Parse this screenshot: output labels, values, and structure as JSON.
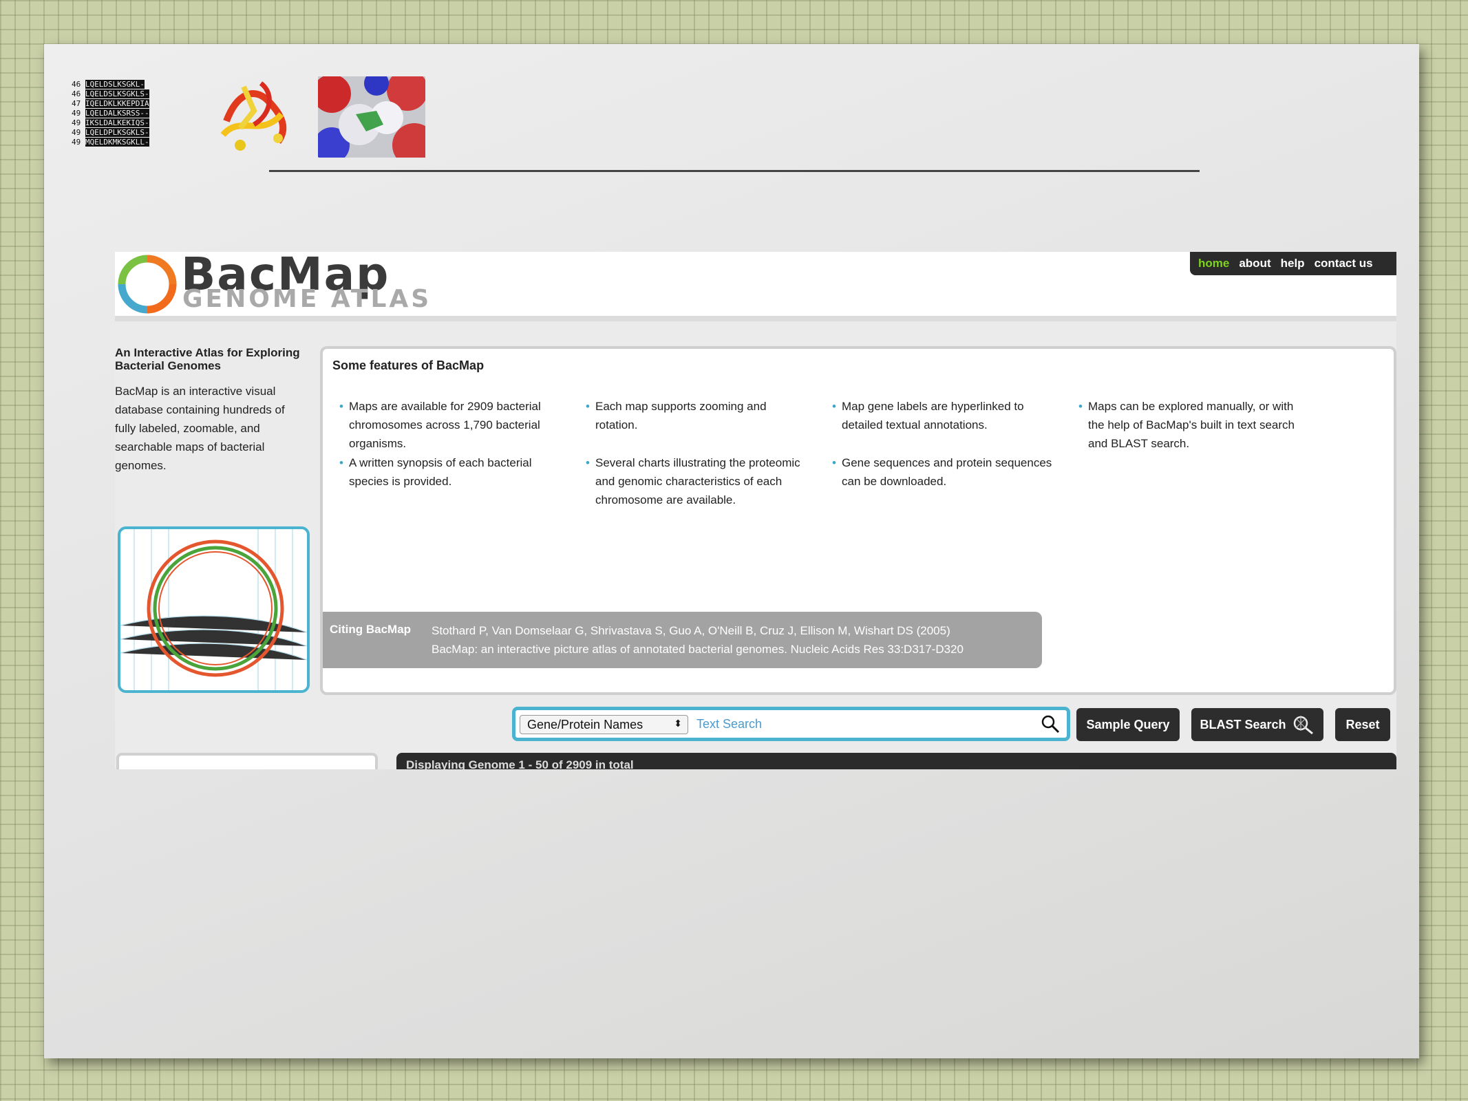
{
  "header": {
    "sequence_rows": [
      {
        "num": "46",
        "seq": "LQELDSLKSGKL-"
      },
      {
        "num": "46",
        "seq": "LQELDSLKSGKLS-"
      },
      {
        "num": "47",
        "seq": "IQELDKLKKEPDIA"
      },
      {
        "num": "49",
        "seq": "LQELDALKSRSS--"
      },
      {
        "num": "49",
        "seq": "IKSLDALKEKIQS-"
      },
      {
        "num": "49",
        "seq": "LQELDPLKSGKLS-"
      },
      {
        "num": "49",
        "seq": "MQELDKMKSGKLL-"
      }
    ]
  },
  "bacmap": {
    "logo_title": "BacMap",
    "logo_subtitle": "GENOME ATLAS",
    "nav": [
      "home",
      "about",
      "help",
      "contact us"
    ],
    "sidebar": {
      "heading": "An Interactive Atlas for Exploring Bacterial Genomes",
      "text": "BacMap is an interactive visual database containing hundreds of fully labeled, zoomable, and searchable maps of bacterial genomes."
    },
    "features": {
      "title": "Some features of BacMap",
      "items": [
        "Maps are available for 2909 bacterial chromosomes across 1,790 bacterial organisms.",
        "Each map supports zooming and rotation.",
        "Map gene labels are hyperlinked to detailed textual annotations.",
        "Maps can be explored manually, or with the help of BacMap's built in text search and BLAST search.",
        "A written synopsis of each bacterial species is provided.",
        "Several charts illustrating the proteomic and genomic characteristics of each chromosome are available.",
        "Gene sequences and protein sequences can be downloaded."
      ]
    },
    "citation": {
      "label": "Citing BacMap",
      "line1": "Stothard P, Van Domselaar G, Shrivastava S, Guo A, O'Neill B, Cruz J, Ellison M, Wishart DS (2005)",
      "line2": "BacMap: an interactive picture atlas of annotated bacterial genomes. Nucleic Acids Res 33:D317-D320"
    },
    "search": {
      "select_value": "Gene/Protein Names",
      "placeholder": "Text Search",
      "sample_query": "Sample Query",
      "blast_search": "BLAST Search",
      "reset": "Reset"
    },
    "bottom_bar": "Displaying Genome 1 - 50 of 2909 in total"
  },
  "colors": {
    "accent_blue": "#4ab4d0",
    "nav_active_green": "#7ed321",
    "dark_button": "#2d2d2d"
  }
}
